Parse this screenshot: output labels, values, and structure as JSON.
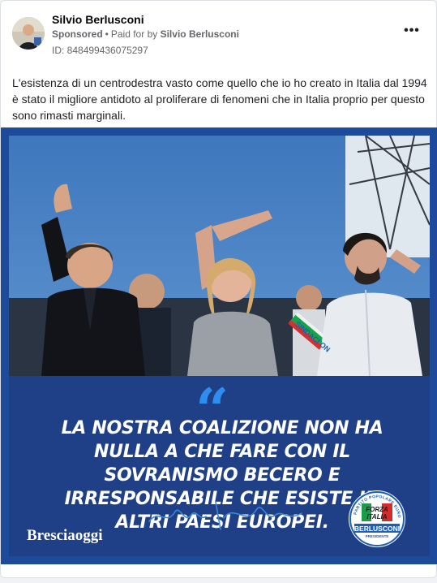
{
  "post": {
    "page_name": "Silvio Berlusconi",
    "sponsored": "Sponsored",
    "separator": "•",
    "paid_for_prefix": "Paid for by",
    "paid_for_name": "Silvio Berlusconi",
    "ad_id": "ID: 848499436075297",
    "more_label": "•••",
    "body": "L'esistenza di un centrodestra vasto come quello che io ho creato in Italia dal 1994 è stato il migliore antidoto al proliferare di fenomeni che in Italia proprio per questo sono rimasti marginali."
  },
  "creative": {
    "quote_mark": "“",
    "quote": "LA NOSTRA COALIZIONE NON HA NULLA A CHE FARE CON IL SOVRANISMO BECERO E IRRESPONSABILE CHE ESISTE IN ALTRI PAESI EUROPEI.",
    "newspaper": "Bresciaoggi",
    "sash_text": "SINDACI ON",
    "logo": {
      "ring_text": "PARTITO POPOLARE EUROPEO",
      "forza": "FORZA",
      "italia": "ITALIA",
      "name": "BERLUSCONI",
      "title": "PRESIDENTE"
    }
  },
  "colors": {
    "frame_blue": "#1d4a9b",
    "panel_blue": "#1f3f86",
    "quote_accent": "#2e8ef0",
    "meta_gray": "#65676b"
  }
}
